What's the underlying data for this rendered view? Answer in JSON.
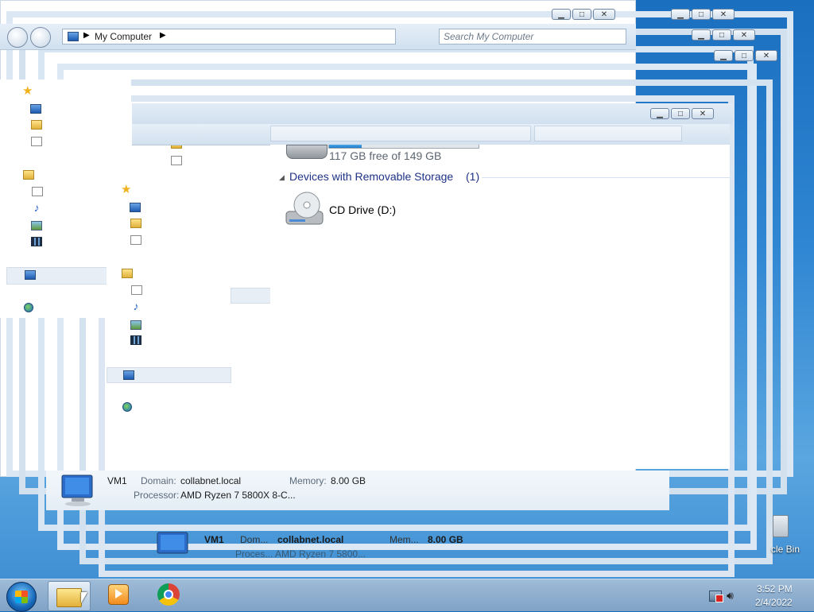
{
  "address": {
    "segment": "My Computer",
    "search_placeholder": "Search My Computer"
  },
  "window_buttons": {
    "minimize": "▁",
    "maximize": "□",
    "close": "✕"
  },
  "content": {
    "drive_free_text": "117 GB free of 149 GB",
    "group_header": "Devices with Removable Storage",
    "group_count": "(1)",
    "cd_drive_label": "CD Drive (D:)"
  },
  "details": {
    "name": "VM1",
    "domain_label": "Domain:",
    "domain_value": "collabnet.local",
    "memory_label": "Memory:",
    "memory_value": "8.00 GB",
    "processor_label": "Processor:",
    "processor_value": "AMD Ryzen 7 5800X 8-C...",
    "ghost_name": "VM1",
    "ghost_domain_label": "Dom...",
    "ghost_domain_value": "collabnet.local",
    "ghost_memory_label": "Mem...",
    "ghost_memory_value": "8.00 GB",
    "ghost_processor": "Proces... AMD Ryzen 7 5800..."
  },
  "desktop": {
    "recycle_bin_label": "cle Bin"
  },
  "taskbar": {
    "time": "3:52 PM",
    "date": "2/4/2022"
  },
  "icons": [
    "favorites-star-icon",
    "desktop-icon",
    "downloads-icon",
    "recent-places-icon",
    "libraries-icon",
    "documents-icon",
    "music-icon",
    "pictures-icon",
    "videos-icon",
    "computer-icon",
    "network-icon",
    "cd-drive-icon",
    "hard-drive-icon",
    "start-orb-icon",
    "explorer-icon",
    "media-player-icon",
    "chrome-icon",
    "network-tray-icon",
    "volume-icon",
    "recycle-bin-icon"
  ]
}
